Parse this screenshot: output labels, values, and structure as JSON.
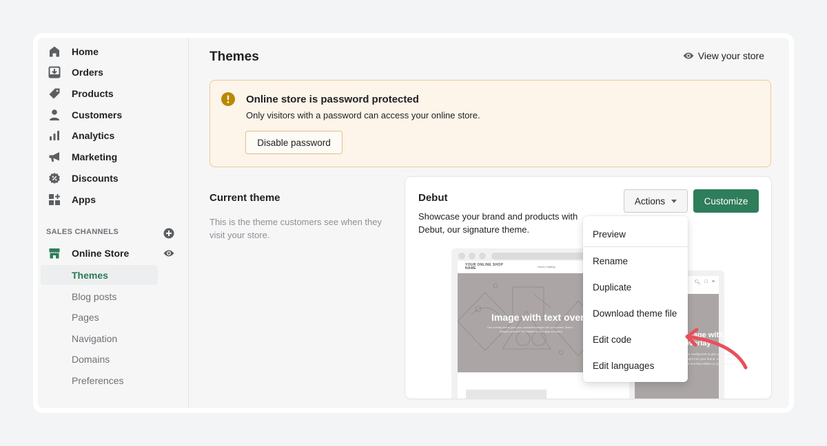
{
  "sidebar": {
    "items": [
      {
        "label": "Home",
        "icon": "home-icon"
      },
      {
        "label": "Orders",
        "icon": "orders-icon"
      },
      {
        "label": "Products",
        "icon": "tag-icon"
      },
      {
        "label": "Customers",
        "icon": "person-icon"
      },
      {
        "label": "Analytics",
        "icon": "bar-chart-icon"
      },
      {
        "label": "Marketing",
        "icon": "megaphone-icon"
      },
      {
        "label": "Discounts",
        "icon": "discount-icon"
      },
      {
        "label": "Apps",
        "icon": "apps-icon"
      }
    ],
    "sales_channels": {
      "title": "SALES CHANNELS",
      "add_icon": "plus-circle-icon",
      "online_store": {
        "label": "Online Store",
        "icon": "store-icon",
        "view_icon": "eye-icon"
      },
      "sub_items": [
        {
          "label": "Themes",
          "active": true
        },
        {
          "label": "Blog posts"
        },
        {
          "label": "Pages"
        },
        {
          "label": "Navigation"
        },
        {
          "label": "Domains"
        },
        {
          "label": "Preferences"
        }
      ]
    }
  },
  "header": {
    "title": "Themes",
    "view_store_label": "View your store"
  },
  "banner": {
    "title": "Online store is password protected",
    "text": "Only visitors with a password can access your online store.",
    "button_label": "Disable password"
  },
  "current_theme": {
    "title": "Current theme",
    "description": "This is the theme customers see when they visit your store."
  },
  "theme_card": {
    "name": "Debut",
    "description": "Showcase your brand and products with Debut, our signature theme.",
    "actions_label": "Actions",
    "customize_label": "Customize",
    "preview": {
      "shop_name": "YOUR ONLINE SHOP NAME",
      "links": "Home   Catalog",
      "hero_title": "Image with text overlay",
      "hero_text_1": "Use overlay text to give your customers insight into your brand. Select",
      "hero_text_2": "imagery and text that relates to your style and story.",
      "mobile_title_1": "Image with text",
      "mobile_title_2": "overlay",
      "mobile_text_1": "Use overlay text to give your customers",
      "mobile_text_2": "insight into your brand. Select imagery",
      "mobile_text_3": "and text that relates to your style and"
    }
  },
  "actions_menu": {
    "items": [
      "Preview",
      "Rename",
      "Duplicate",
      "Download theme file",
      "Edit code",
      "Edit languages"
    ],
    "highlighted": "Edit code"
  },
  "colors": {
    "primary": "#2e7d5b",
    "active_text": "#2a7a55",
    "warning_bg": "#fdf4ea",
    "warning_icon": "#b98900",
    "annotation_arrow": "#e8505b"
  }
}
